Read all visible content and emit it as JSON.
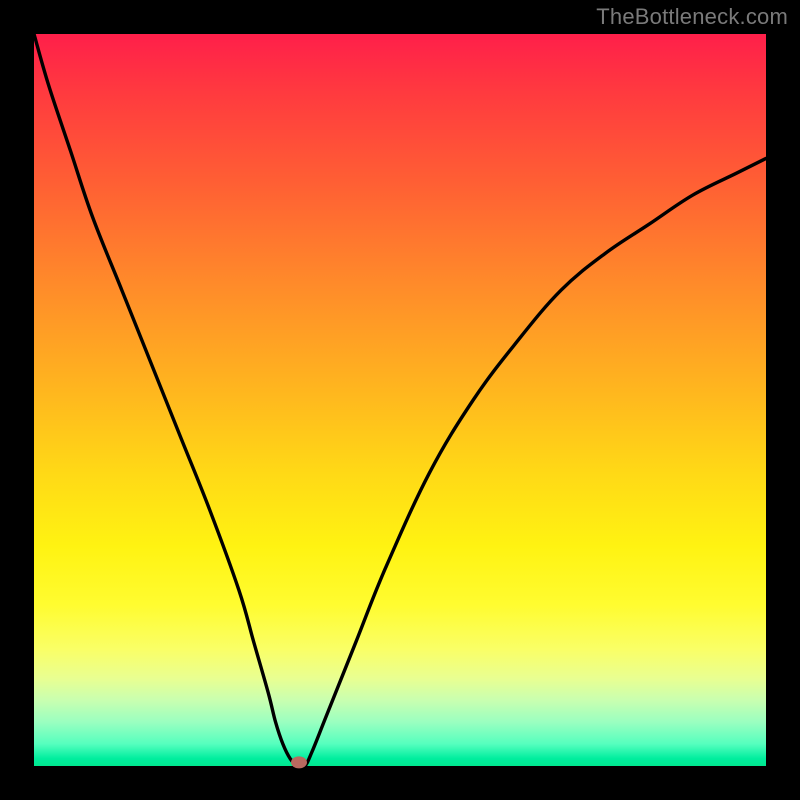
{
  "watermark": "TheBottleneck.com",
  "chart_data": {
    "type": "line",
    "title": "",
    "xlabel": "",
    "ylabel": "",
    "xlim": [
      0,
      100
    ],
    "ylim": [
      0,
      100
    ],
    "grid": false,
    "legend": false,
    "background_gradient": {
      "direction": "vertical",
      "stops": [
        {
          "pos": 0.0,
          "color": "#ff1f4a"
        },
        {
          "pos": 0.5,
          "color": "#ffd916"
        },
        {
          "pos": 1.0,
          "color": "#00e88f"
        }
      ],
      "meaning": "top=red=high-bottleneck, bottom=green=low-bottleneck"
    },
    "series": [
      {
        "name": "bottleneck-curve",
        "x": [
          0,
          2,
          5,
          8,
          12,
          16,
          20,
          24,
          28,
          30,
          32,
          33,
          34,
          35,
          36,
          37,
          38,
          40,
          44,
          48,
          54,
          60,
          66,
          72,
          78,
          84,
          90,
          96,
          100
        ],
        "values": [
          100,
          93,
          84,
          75,
          65,
          55,
          45,
          35,
          24,
          17,
          10,
          6,
          3,
          1,
          0,
          0,
          2,
          7,
          17,
          27,
          40,
          50,
          58,
          65,
          70,
          74,
          78,
          81,
          83
        ]
      }
    ],
    "marker": {
      "x": 36.2,
      "y": 0.5,
      "color": "#b96a60"
    }
  }
}
